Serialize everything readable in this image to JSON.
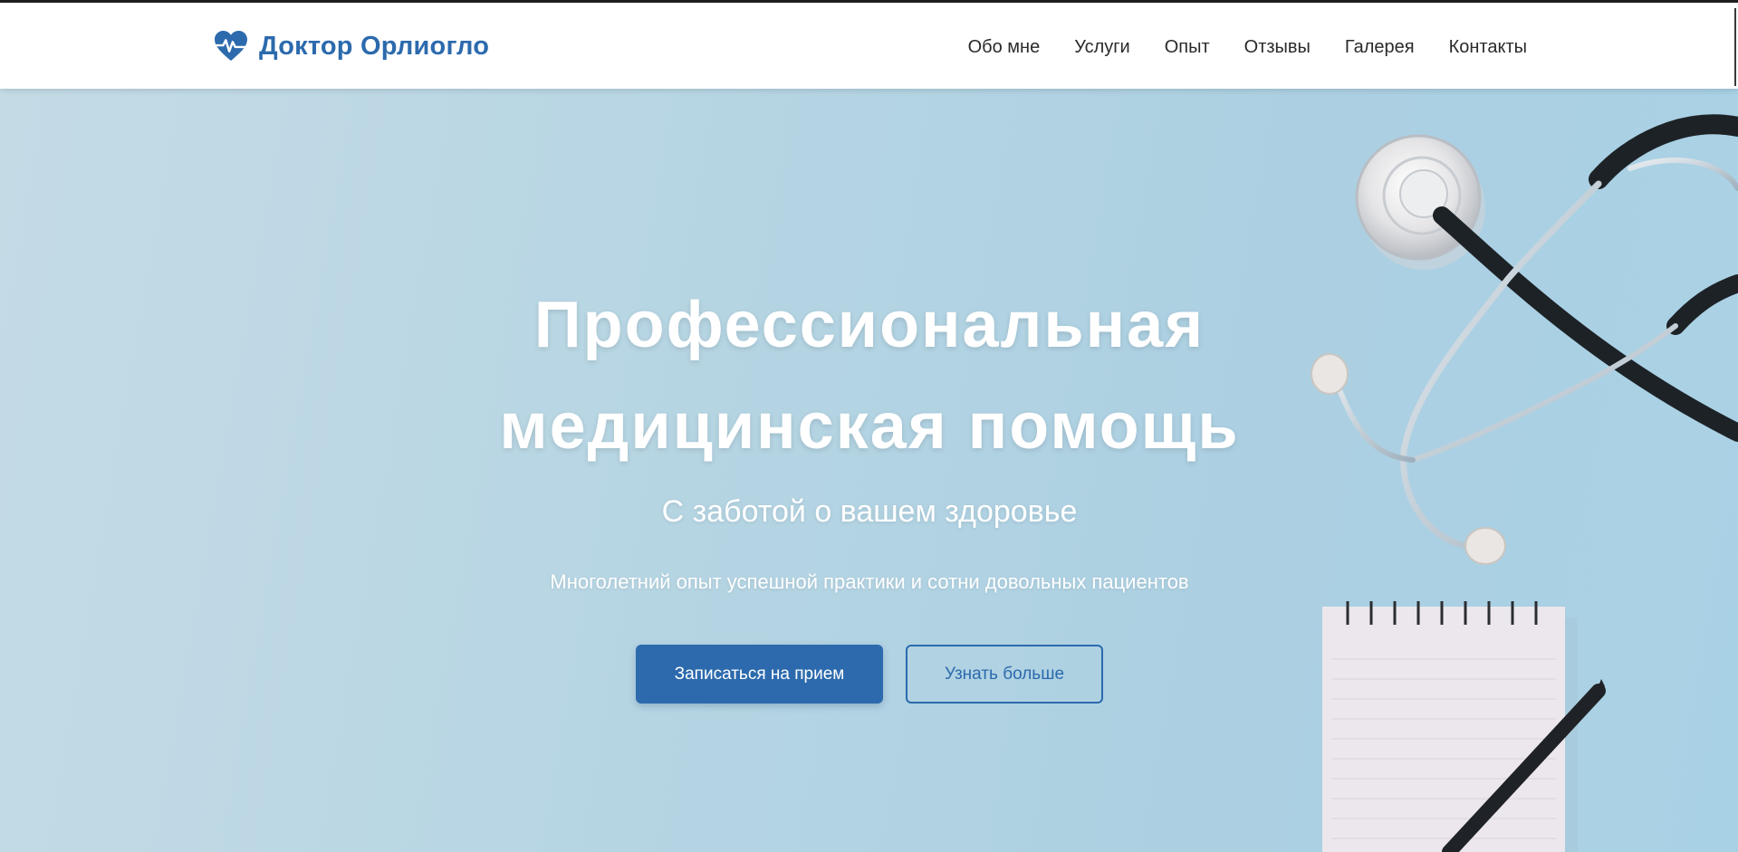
{
  "header": {
    "brand_name": "Доктор Орлиогло",
    "brand_icon": "heart-pulse-icon",
    "nav": [
      {
        "label": "Обо мне"
      },
      {
        "label": "Услуги"
      },
      {
        "label": "Опыт"
      },
      {
        "label": "Отзывы"
      },
      {
        "label": "Галерея"
      },
      {
        "label": "Контакты"
      }
    ]
  },
  "hero": {
    "title_line1": "Профессиональная",
    "title_line2": "медицинская помощь",
    "subtitle": "С заботой о вашем здоровье",
    "description": "Многолетний опыт успешной практики и сотни довольных пациентов",
    "primary_button": "Записаться на прием",
    "secondary_button": "Узнать больше",
    "image_items": [
      "stethoscope",
      "notepad",
      "pencil"
    ]
  },
  "colors": {
    "brand": "#2c6aad",
    "hero_background": "#b3d3e2",
    "text_light": "#ffffff",
    "nav_text": "#2a2a2a"
  }
}
